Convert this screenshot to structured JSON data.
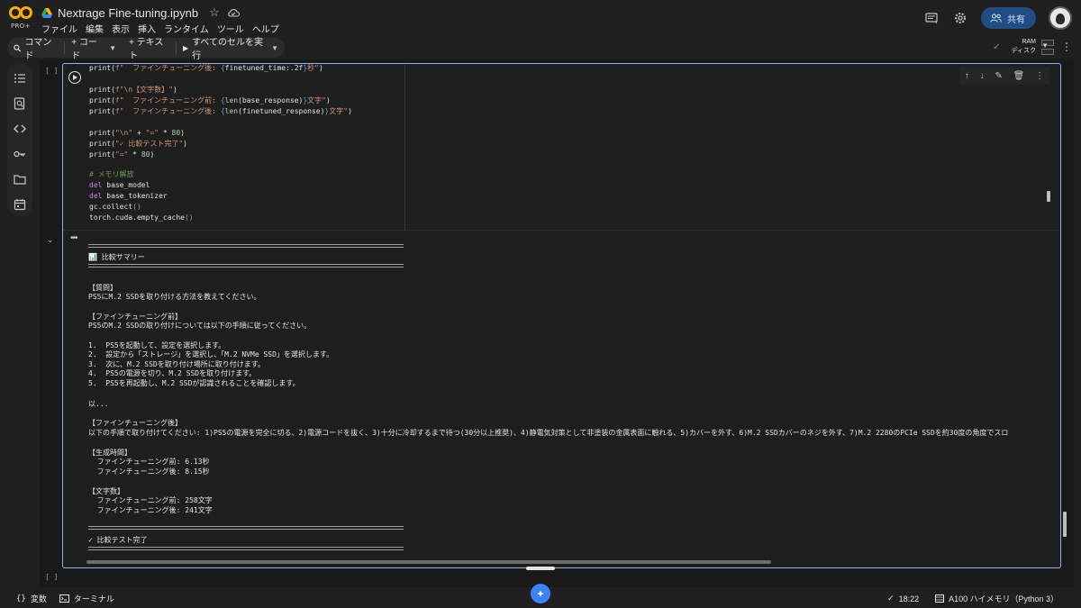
{
  "app": {
    "logo_badge": "PRO+",
    "notebook_title": "Nextrage Fine-tuning.ipynb",
    "menu": [
      "ファイル",
      "編集",
      "表示",
      "挿入",
      "ランタイム",
      "ツール",
      "ヘルプ"
    ],
    "share_label": "共有"
  },
  "toolbar": {
    "command_label": "コマンド",
    "add_code_label": "+ コード",
    "add_text_label": "+ テキスト",
    "run_all_label": "すべてのセルを実行",
    "ram_label": "RAM",
    "disk_label": "ディスク"
  },
  "cell": {
    "exec_bracket": "[ ]",
    "code_lines": [
      "print(f\"  ファインチューニング後: {finetuned_time:.2f}秒\")",
      "",
      "print(f\"\\n【文字数】\")",
      "print(f\"  ファインチューニング前: {len(base_response)}文字\")",
      "print(f\"  ファインチューニング後: {len(finetuned_response)}文字\")",
      "",
      "print(\"\\n\" + \"=\" * 80)",
      "print(\"✓ 比較テスト完了\")",
      "print(\"=\" * 80)",
      "",
      "# メモリ解放",
      "del base_model",
      "del base_tokenizer",
      "gc.collect()",
      "torch.cuda.empty_cache()"
    ],
    "output_lines": [
      "📊 比較サマリー",
      "【質問】",
      "PS5にM.2 SSDを取り付ける方法を教えてください。",
      "【ファインチューニング前】",
      "PS5のM.2 SSDの取り付けについては以下の手順に従ってください。",
      "1.  PS5を起動して、設定を選択します。",
      "2.  設定から「ストレージ」を選択し、「M.2 NVMe SSD」を選択します。",
      "3.  次に、M.2 SSDを取り付け場所に取り付けます。",
      "4.  PS5の電源を切り、M.2 SSDを取り付けます。",
      "5.  PS5を再起動し、M.2 SSDが認識されることを確認します。",
      "以...",
      "【ファインチューニング後】",
      "以下の手順で取り付けてください: 1)PS5の電源を完全に切る、2)電源コードを抜く、3)十分に冷却するまで待つ(30分以上推奨)、4)静電気対策として非塗装の金属表面に触れる、5)カバーを外す、6)M.2 SSDカバーのネジを外す、7)M.2 2280のPCIe SSDを約30度の角度でスロ",
      "【生成時間】",
      "  ファインチューニング前: 6.13秒",
      "  ファインチューニング後: 8.15秒",
      "【文字数】",
      "  ファインチューニング前: 258文字",
      "  ファインチューニング後: 241文字",
      "✓ 比較テスト完了"
    ]
  },
  "statusbar": {
    "variables_label": "変数",
    "terminal_label": "ターミナル",
    "time": "18:22",
    "runtime": "A100 ハイメモリ（Python 3）"
  }
}
